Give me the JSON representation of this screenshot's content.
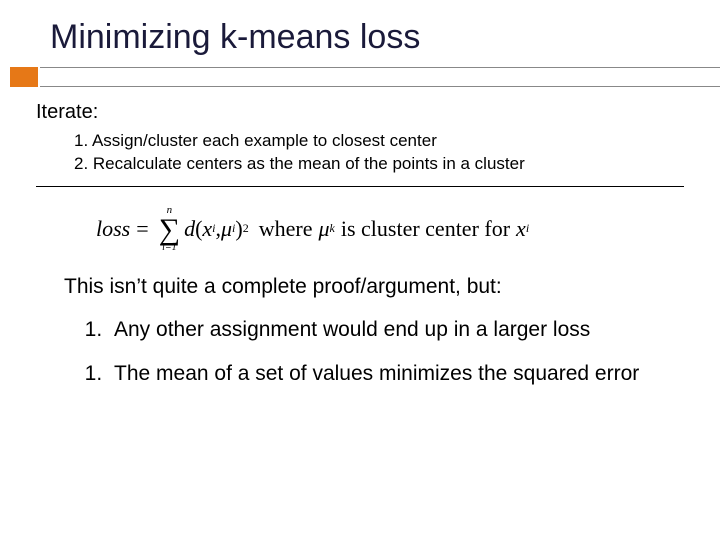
{
  "title": "Minimizing k-means loss",
  "iterate_label": "Iterate:",
  "steps": {
    "s1": "1. Assign/cluster each example to closest center",
    "s2": "2. Recalculate centers as the mean of the points in a cluster"
  },
  "formula": {
    "loss": "loss",
    "eq": "=",
    "sum_top": "n",
    "sum_bot": "i=1",
    "d": "d",
    "lp": "(",
    "x": "x",
    "i": "i",
    "comma": ",",
    "mu": "μ",
    "k": "i",
    "rp": ")",
    "sq": "2",
    "where": "where",
    "mu2": "μ",
    "k2": "k",
    "isfor": "is cluster center for",
    "x2": "x",
    "i2": "i"
  },
  "lead": "This isn’t quite a complete proof/argument, but:",
  "points": {
    "p1": "Any other assignment would end up in a larger loss",
    "p2": "The mean of a set of values minimizes the squared error"
  }
}
